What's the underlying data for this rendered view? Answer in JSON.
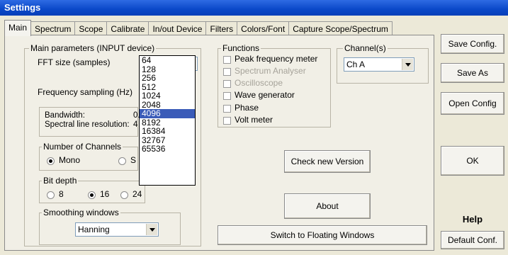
{
  "window": {
    "title": "Settings"
  },
  "tabs": [
    "Main",
    "Spectrum",
    "Scope",
    "Calibrate",
    "In/out Device",
    "Filters",
    "Colors/Font",
    "Capture Scope/Spectrum"
  ],
  "main_params": {
    "legend": "Main parameters (INPUT device)",
    "fft_label": "FFT size (samples)",
    "fft_value": "4096",
    "fft_options": [
      "64",
      "128",
      "256",
      "512",
      "1024",
      "2048",
      "4096",
      "8192",
      "16384",
      "32767",
      "65536"
    ],
    "fft_selected": "4096",
    "freq_label": "Frequency sampling (Hz)",
    "bandwidth_label": "Bandwidth:",
    "bandwidth_value": "0.",
    "resolution_label": "Spectral line resolution:",
    "resolution_value": "4"
  },
  "channels_group": {
    "legend": "Number of Channels",
    "mono": "Mono",
    "stereo_partial": "S"
  },
  "bit_depth": {
    "legend": "Bit depth",
    "options": [
      "8",
      "16",
      "24"
    ],
    "selected": "16"
  },
  "smoothing": {
    "legend": "Smoothing windows",
    "value": "Hanning"
  },
  "functions": {
    "legend": "Functions",
    "items": [
      {
        "label": "Peak frequency meter",
        "enabled": true
      },
      {
        "label": "Spectrum Analyser",
        "enabled": false
      },
      {
        "label": "Oscilloscope",
        "enabled": false
      },
      {
        "label": "Wave generator",
        "enabled": true
      },
      {
        "label": "Phase",
        "enabled": true
      },
      {
        "label": "Volt meter",
        "enabled": true
      }
    ]
  },
  "channels": {
    "legend": "Channel(s)",
    "value": "Ch A"
  },
  "buttons": {
    "check_version": "Check new Version",
    "about": "About",
    "floating": "Switch to Floating Windows",
    "save_config": "Save Config.",
    "save_as": "Save As",
    "open_config": "Open Config",
    "ok": "OK",
    "help": "Help",
    "default_conf": "Default Conf."
  }
}
